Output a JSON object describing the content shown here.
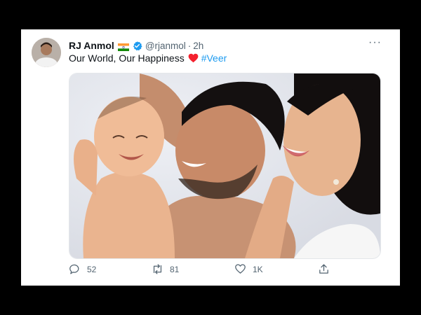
{
  "tweet": {
    "author_name": "RJ Anmol",
    "handle": "@rjanmol",
    "separator": "·",
    "time": "2h",
    "text": "Our World, Our Happiness",
    "hashtag": "#Veer",
    "more_label": "···"
  },
  "actions": {
    "replies": "52",
    "retweets": "81",
    "likes": "1K"
  },
  "colors": {
    "accent": "#1d9bf0",
    "text": "#0f1419",
    "muted": "#536471",
    "heart": "#f4212e"
  },
  "icons": {
    "flag": "india-flag-icon",
    "verified": "verified-badge-icon",
    "heart": "red-heart-icon",
    "reply": "reply-icon",
    "retweet": "retweet-icon",
    "like": "like-icon",
    "share": "share-icon"
  }
}
